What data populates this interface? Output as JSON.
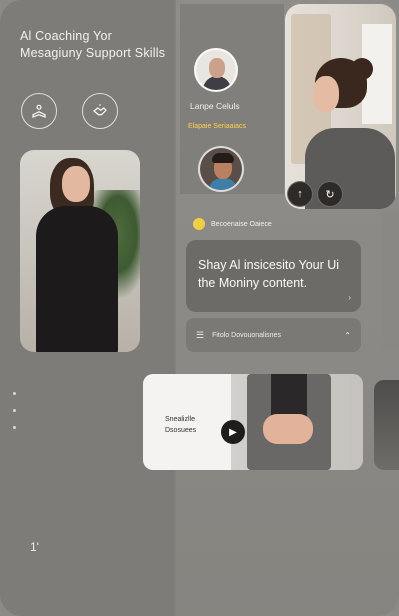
{
  "app": {
    "title": "Al Coaching Yor Mesagiuny Support Skills"
  },
  "left_panel": {
    "glyph": "1'"
  },
  "profile": {
    "name": "Lanpe Celuls",
    "role": "Elapaie Seriaaiacs"
  },
  "status": {
    "label": "Becoenaise Oaiece",
    "color": "#f1cf44"
  },
  "prompt": {
    "text": "Shay Al insicesito Your Ui the Moniny content."
  },
  "option": {
    "label": "Fitolo Dovouonalisnes"
  },
  "card": {
    "text_line1": "Snealizlle",
    "text_line2": "Dsosuees"
  },
  "icons": {
    "reader": "reader-icon",
    "handshake": "handshake-icon",
    "up_arrow": "arrow-up-icon",
    "sync": "sync-icon",
    "play": "play-icon",
    "chevron": "chevron-icon"
  }
}
